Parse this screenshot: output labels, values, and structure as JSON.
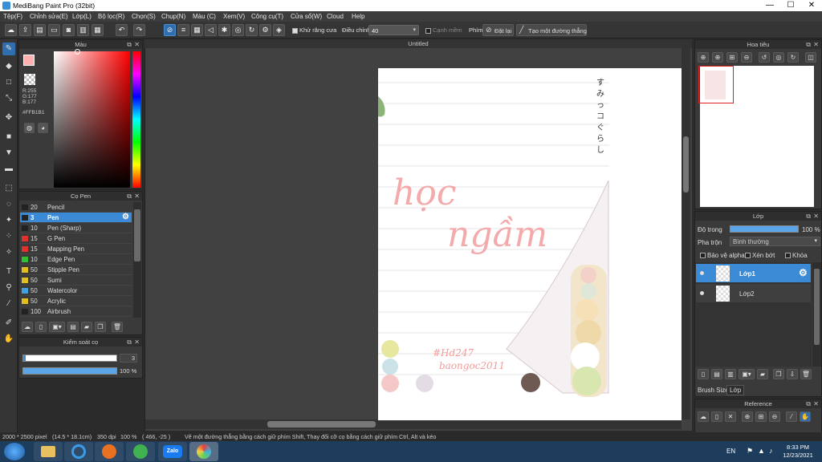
{
  "window": {
    "title": "MediBang Paint Pro (32bit)",
    "min": "—",
    "max": "☐",
    "close": "✕"
  },
  "menu": [
    "Tệp(F)",
    "Chỉnh sửa(E)",
    "Lớp(L)",
    "Bộ lọc(R)",
    "Chọn(S)",
    "Chụp(N)",
    "Màu (C)",
    "Xem(V)",
    "Công cụ(T)",
    "Cửa sổ(W)",
    "Cloud",
    "Help"
  ],
  "toolbar": {
    "antialias": "Khử răng cưa",
    "adjust": "Điều chỉnh",
    "adjust_value": "40",
    "edge": "Cạnh mềm",
    "key": "Phím",
    "reset": "Đặt lại",
    "straight": "Tạo một đường thẳng"
  },
  "color_panel": {
    "title": "Màu",
    "r": "R:255",
    "g": "G:177",
    "b": "B:177",
    "hex": "#FFB1B1",
    "fg": "#FFB1B1"
  },
  "brush_panel": {
    "title": "Cọ Pen",
    "items": [
      {
        "size": "20",
        "name": "Pencil",
        "color": "#222222"
      },
      {
        "size": "3",
        "name": "Pen",
        "color": "#222222"
      },
      {
        "size": "10",
        "name": "Pen (Sharp)",
        "color": "#222222"
      },
      {
        "size": "15",
        "name": "G Pen",
        "color": "#e03030"
      },
      {
        "size": "15",
        "name": "Mapping Pen",
        "color": "#e03030"
      },
      {
        "size": "10",
        "name": "Edge Pen",
        "color": "#30c030"
      },
      {
        "size": "50",
        "name": "Stipple Pen",
        "color": "#e0c020"
      },
      {
        "size": "50",
        "name": "Sumi",
        "color": "#e0c020"
      },
      {
        "size": "50",
        "name": "Watercolor",
        "color": "#40a0e0"
      },
      {
        "size": "50",
        "name": "Acrylic",
        "color": "#e0c020"
      },
      {
        "size": "100",
        "name": "Airbrush",
        "color": "#222222"
      }
    ]
  },
  "brush_control": {
    "title": "Kiểm soát cọ",
    "size": "3",
    "opacity": "100 %"
  },
  "document": {
    "tab": "Untitled",
    "text1": "học",
    "text2": "ngầm",
    "text3": "#Hd247",
    "text4": "baongoc2011",
    "vertical": "すみっコぐらし"
  },
  "navigator": {
    "title": "Hoa tiêu"
  },
  "layer_panel": {
    "title": "Lớp",
    "opacity_label": "Độ trong",
    "opacity_value": "100 %",
    "blend_label": "Pha trộn",
    "blend_value": "Bình thường",
    "protect": "Bảo vệ alpha",
    "clip": "Xén bớt",
    "lock": "Khóa",
    "layers": [
      "Lớp1",
      "Lớp2"
    ],
    "tab_brush": "Brush Size",
    "tab_layer": "Lớp"
  },
  "reference": {
    "title": "Reference"
  },
  "status": {
    "size": "2000 * 2500 pixel",
    "cm": "(14.5 * 18.1cm)",
    "dpi": "350 dpi",
    "zoom": "100 %",
    "coords": "( 466, -25 )",
    "hint": "Vẽ một đường thẳng bằng cách giữ phím Shift, Thay đổi cỡ cọ bằng cách giữ phím Ctrl, Alt và kéo"
  },
  "taskbar": {
    "lang": "EN",
    "time": "8:33 PM",
    "date": "12/23/2021",
    "zalo": "Zalo"
  }
}
